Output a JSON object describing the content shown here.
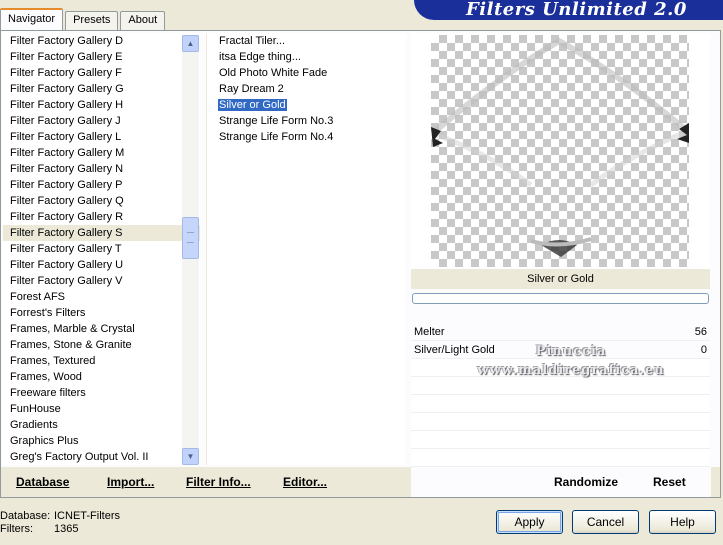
{
  "tabs": [
    "Navigator",
    "Presets",
    "About"
  ],
  "title": "Filters Unlimited 2.0",
  "categories": [
    "Filter Factory Gallery D",
    "Filter Factory Gallery E",
    "Filter Factory Gallery F",
    "Filter Factory Gallery G",
    "Filter Factory Gallery H",
    "Filter Factory Gallery J",
    "Filter Factory Gallery L",
    "Filter Factory Gallery M",
    "Filter Factory Gallery N",
    "Filter Factory Gallery P",
    "Filter Factory Gallery Q",
    "Filter Factory Gallery R",
    "Filter Factory Gallery S",
    "Filter Factory Gallery T",
    "Filter Factory Gallery U",
    "Filter Factory Gallery V",
    "Forest AFS",
    "Forrest's Filters",
    "Frames, Marble & Crystal",
    "Frames, Stone & Granite",
    "Frames, Textured",
    "Frames, Wood",
    "Freeware filters",
    "FunHouse",
    "Gradients",
    "Graphics Plus",
    "Greg's Factory Output Vol. II"
  ],
  "selected_category": "Filter Factory Gallery S",
  "filters": [
    "Fractal Tiler...",
    "itsa Edge thing...",
    "Old Photo White Fade",
    "Ray Dream 2",
    "Silver or Gold",
    "Strange Life Form No.3",
    "Strange Life Form No.4"
  ],
  "selected_filter": "Silver or Gold",
  "preview_filter_name": "Silver or Gold",
  "parameters": [
    {
      "label": "Melter",
      "value": "56"
    },
    {
      "label": "Silver/Light Gold",
      "value": "0"
    }
  ],
  "watermark": [
    "Pinuccia",
    "www.maldiregrafica.eu"
  ],
  "links": {
    "database": "Database",
    "import": "Import...",
    "filter_info": "Filter Info...",
    "editor": "Editor...",
    "randomize": "Randomize",
    "reset": "Reset"
  },
  "status": {
    "database_label": "Database:",
    "database_value": "ICNET-Filters",
    "filters_label": "Filters:",
    "filters_value": "1365"
  },
  "buttons": {
    "apply": "Apply",
    "cancel": "Cancel",
    "help": "Help"
  }
}
